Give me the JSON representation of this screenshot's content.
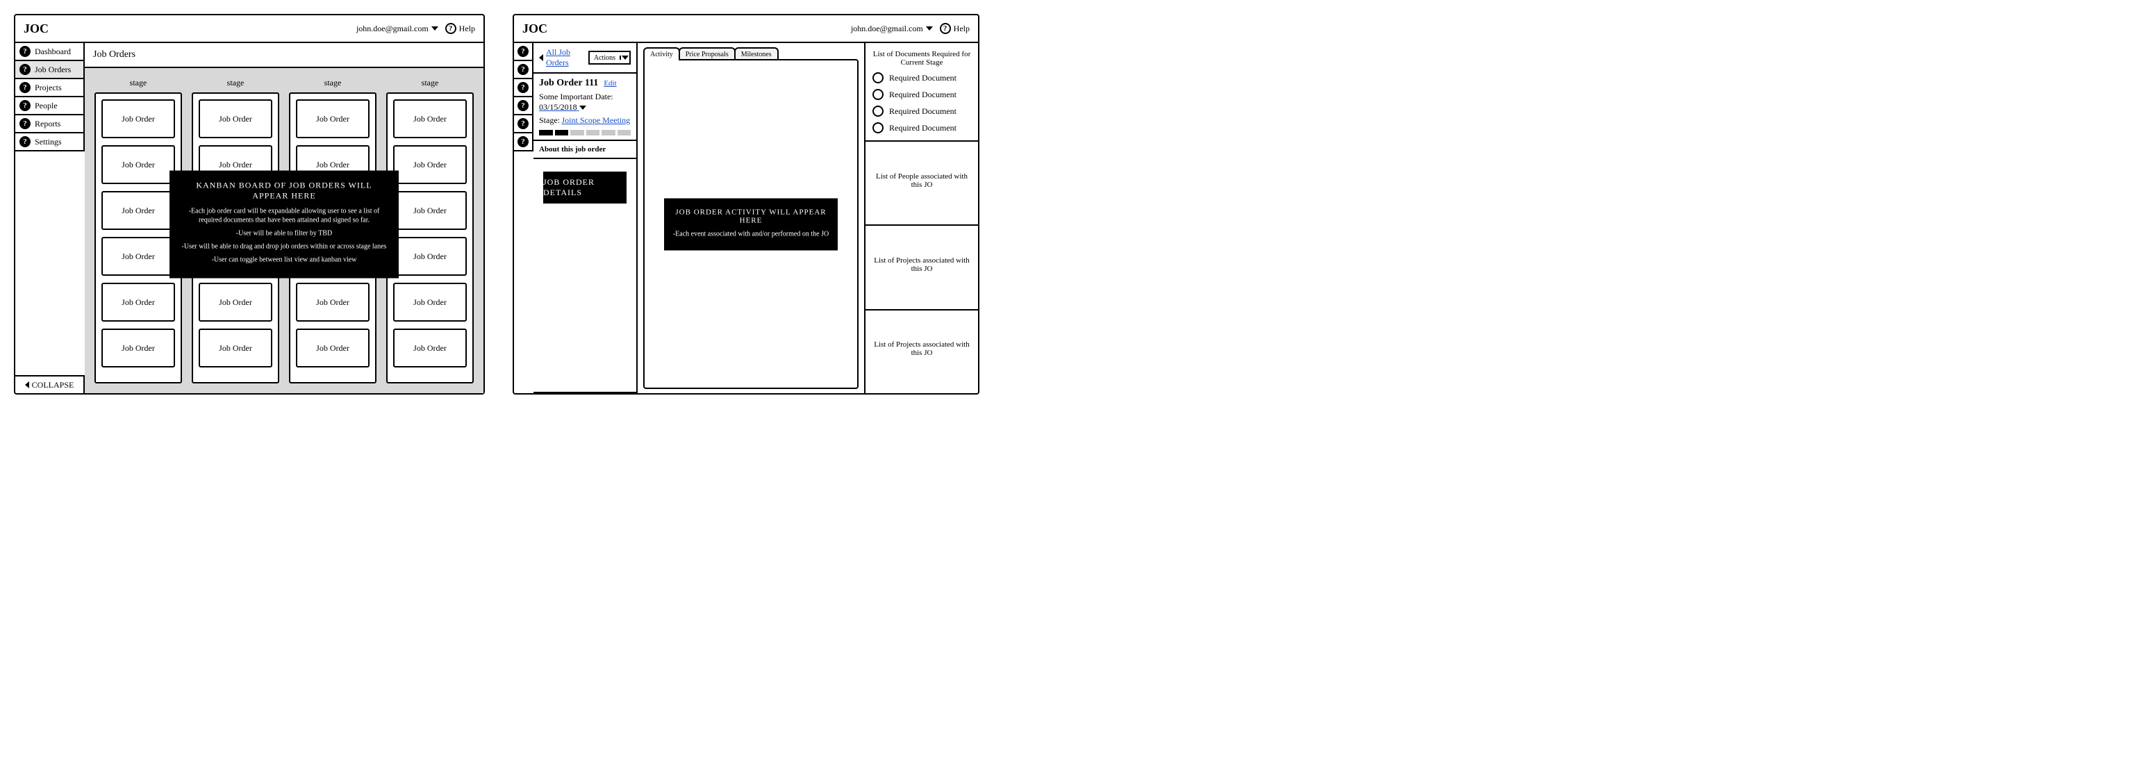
{
  "header": {
    "brand": "JOC",
    "user_email": "john.doe@gmail.com",
    "help_label": "Help"
  },
  "sidebar": {
    "items": [
      {
        "label": "Dashboard"
      },
      {
        "label": "Job Orders"
      },
      {
        "label": "Projects"
      },
      {
        "label": "People"
      },
      {
        "label": "Reports"
      },
      {
        "label": "Settings"
      }
    ],
    "collapse_label": "COLLAPSE"
  },
  "left": {
    "page_title": "Job Orders",
    "lane_title": "stage",
    "card_label": "Job Order",
    "overlay": {
      "title": "KANBAN BOARD OF JOB ORDERS WILL APPEAR HERE",
      "line1": "-Each job order card will be expandable allowing user to see a list of required documents that have been attained and signed so far.",
      "line2": "-User will be able to filter by TBD",
      "line3": "-User will be able to drag and drop job orders within or across stage lanes",
      "line4": "-User can toggle between list view and kanban view"
    }
  },
  "right": {
    "back_link": "All Job Orders",
    "actions_label": "Actions",
    "jo_title": "Job Order 111",
    "edit_label": "Edit",
    "date_label": "Some Important Date:",
    "date_value": "03/15/2018",
    "stage_label": "Stage:",
    "stage_value": "Joint Scope Meeting",
    "progress": [
      true,
      true,
      false,
      false,
      false,
      false
    ],
    "about_title": "About this job order",
    "details_label": "JOB ORDER DETAILS",
    "tabs": [
      "Activity",
      "Price Proposals",
      "Milestones"
    ],
    "overlay": {
      "title": "JOB ORDER ACTIVITY WILL APPEAR HERE",
      "line1": "-Each event associated with and/or performed on the JO"
    },
    "panels": {
      "docs_title": "List of Documents Required for Current Stage",
      "doc_item": "Required Document",
      "people_title": "List of People associated with this JO",
      "projects_title": "List of Projects associated with this JO",
      "projects2_title": "List of Projects associated with this JO"
    }
  }
}
